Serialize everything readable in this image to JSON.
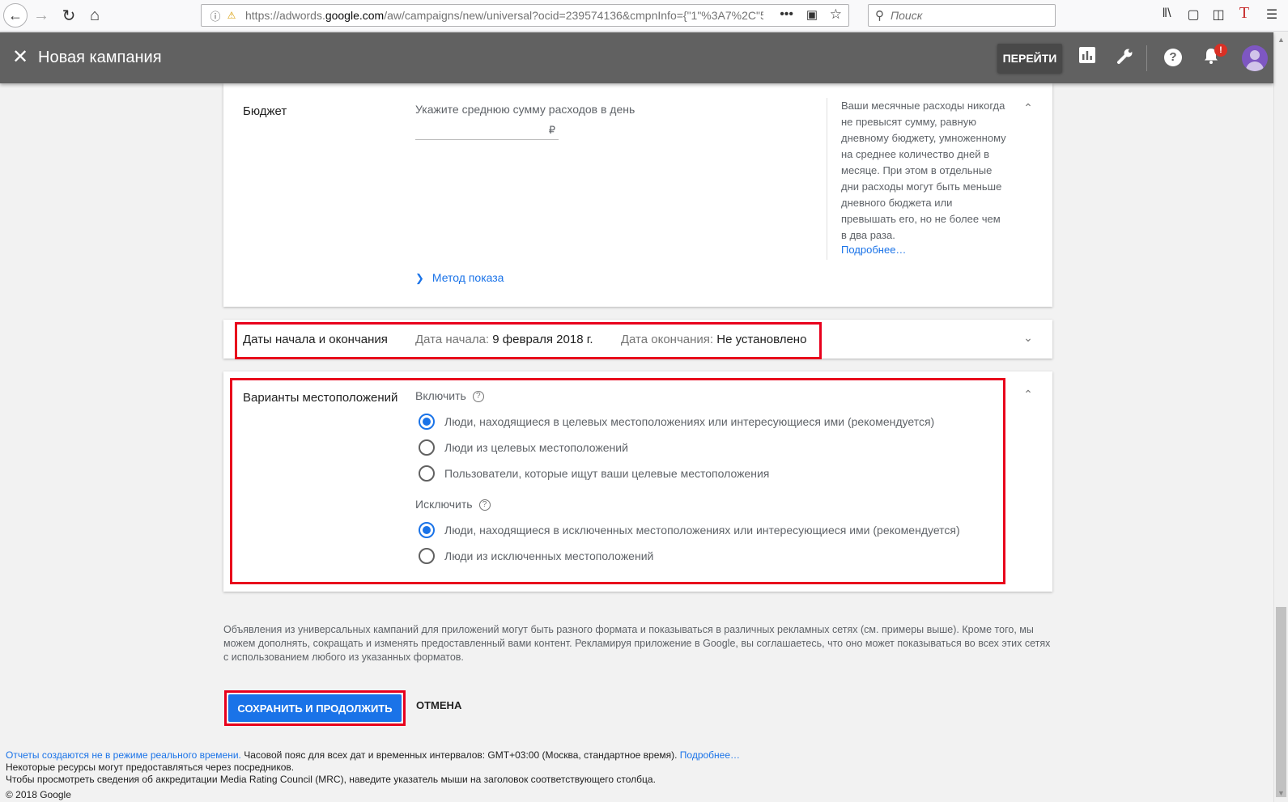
{
  "browser": {
    "url_prefix": "https://adwords.",
    "url_domain": "google.com",
    "url_rest": "/aw/campaigns/new/universal?ocid=239574136&cmpnInfo={\"1\"%3A7%2C\"5",
    "more": "•••",
    "search_placeholder": "Поиск"
  },
  "header": {
    "title": "Новая кампания",
    "go_label": "ПЕРЕЙТИ",
    "notification_badge": "!"
  },
  "budget": {
    "title": "Бюджет",
    "hint": "Укажите среднюю сумму расходов в день",
    "currency": "₽",
    "method_link": "Метод показа",
    "side_note": "Ваши месячные расходы никогда не превысят сумму, равную дневному бюджету, умноженному на среднее количество дней в месяце. При этом в отдельные дни расходы могут быть меньше дневного бюджета или превышать его, но не более чем в два раза.",
    "side_more": "Подробнее…"
  },
  "dates": {
    "title": "Даты начала и окончания",
    "start_label": "Дата начала:",
    "start_value": "9 февраля 2018 г.",
    "end_label": "Дата окончания:",
    "end_value": "Не установлено"
  },
  "locations": {
    "title": "Варианты местоположений",
    "include_label": "Включить",
    "include_options": [
      {
        "label": "Люди, находящиеся в целевых местоположениях или интересующиеся ими (рекомендуется)",
        "selected": true
      },
      {
        "label": "Люди из целевых местоположений",
        "selected": false
      },
      {
        "label": "Пользователи, которые ищут ваши целевые местоположения",
        "selected": false
      }
    ],
    "exclude_label": "Исключить",
    "exclude_options": [
      {
        "label": "Люди, находящиеся в исключенных местоположениях или интересующиеся ими (рекомендуется)",
        "selected": true
      },
      {
        "label": "Люди из исключенных местоположений",
        "selected": false
      }
    ]
  },
  "disclaimer": "Объявления из универсальных кампаний для приложений могут быть разного формата и показываться в различных рекламных сетях (см. примеры выше). Кроме того, мы можем дополнять, сокращать и изменять предоставленный вами контент. Рекламируя приложение в Google, вы соглашаетесь, что оно может показываться во всех этих сетях с использованием любого из указанных форматов.",
  "actions": {
    "save": "СОХРАНИТЬ И ПРОДОЛЖИТЬ",
    "cancel": "ОТМЕНА"
  },
  "footer": {
    "line1_link": "Отчеты создаются не в режиме реального времени.",
    "line1_text": " Часовой пояс для всех дат и временных интервалов: GMT+03:00 (Москва, стандартное время). ",
    "line1_more": "Подробнее…",
    "line2": "Некоторые ресурсы могут предоставляться через посредников.",
    "line3": "Чтобы просмотреть сведения об аккредитации Media Rating Council (MRC), наведите указатель мыши на заголовок соответствующего столбца.",
    "copyright": "© 2018 Google"
  },
  "colors": {
    "accent": "#1a73e8",
    "header_bg": "#616161",
    "highlight": "#e8001c"
  }
}
